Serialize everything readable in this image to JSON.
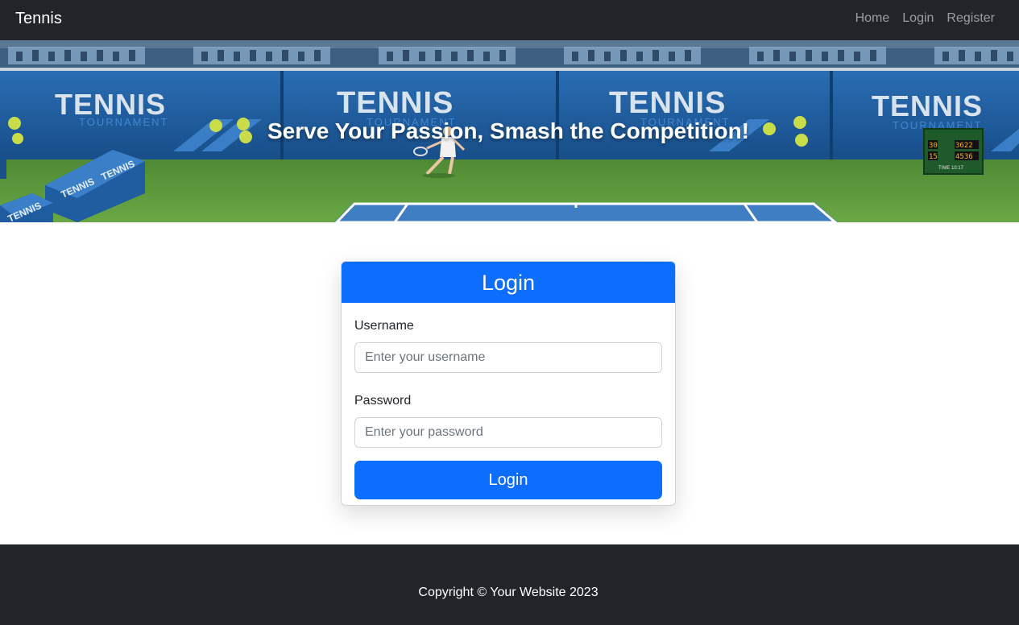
{
  "navbar": {
    "brand": "Tennis",
    "links": [
      {
        "label": "Home"
      },
      {
        "label": "Login"
      },
      {
        "label": "Register"
      }
    ]
  },
  "hero": {
    "title": "Serve Your Passion, Smash the Competition!",
    "banner_words": {
      "main": "TENNIS",
      "sub": "TOURNAMENT"
    },
    "scoreboard": {
      "row1_a": "30",
      "row1_b": "3622",
      "row2_a": "15",
      "row2_b": "4536",
      "footer": "TIME 10:17"
    }
  },
  "login": {
    "title": "Login",
    "username_label": "Username",
    "username_placeholder": "Enter your username",
    "password_label": "Password",
    "password_placeholder": "Enter your password",
    "submit_label": "Login"
  },
  "footer": {
    "text": "Copyright © Your Website 2023"
  },
  "colors": {
    "navbar": "#212529",
    "primary": "#0d6efd",
    "footer": "#212529",
    "court_green": "#5f9b3c",
    "court_blue": "#3f7ec2"
  }
}
